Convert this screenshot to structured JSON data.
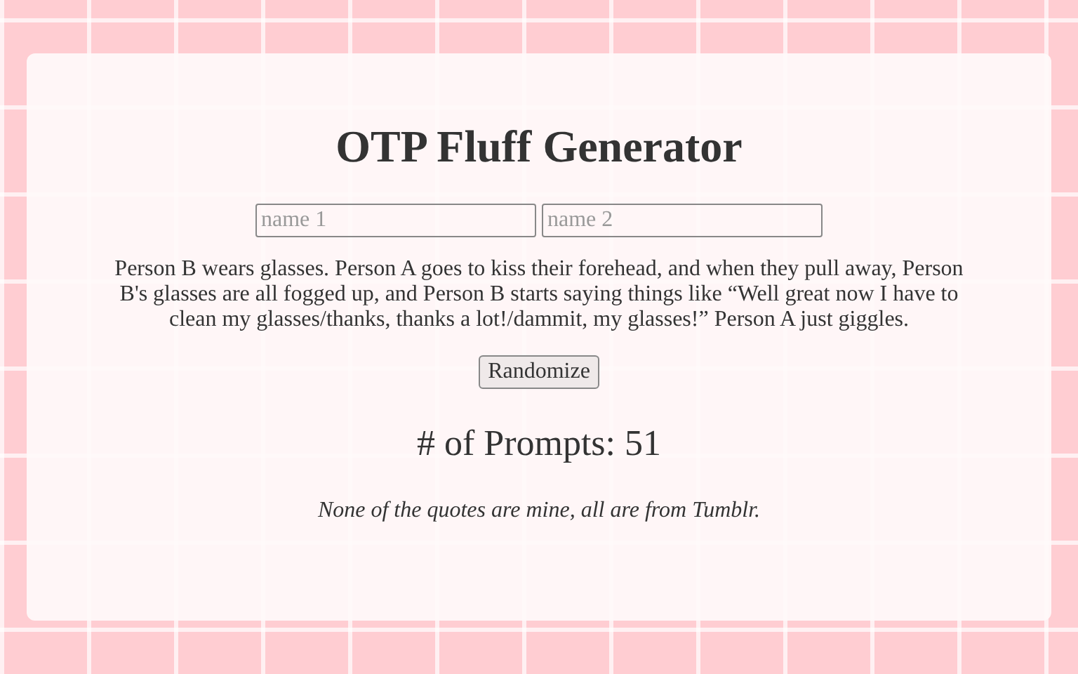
{
  "title": "OTP Fluff Generator",
  "inputs": [
    {
      "placeholder": "name 1"
    },
    {
      "placeholder": "name 2"
    }
  ],
  "prompt": "Person B wears glasses. Person A goes to kiss their forehead, and when they pull away, Person B's glasses are all fogged up, and Person B starts saying things like “Well great now I have to clean my glasses/thanks, thanks a lot!/dammit, my glasses!” Person A just giggles.",
  "button": "Randomize",
  "count": "# of Prompts: 51",
  "disclaimer": "None of the quotes are mine, all are from Tumblr."
}
